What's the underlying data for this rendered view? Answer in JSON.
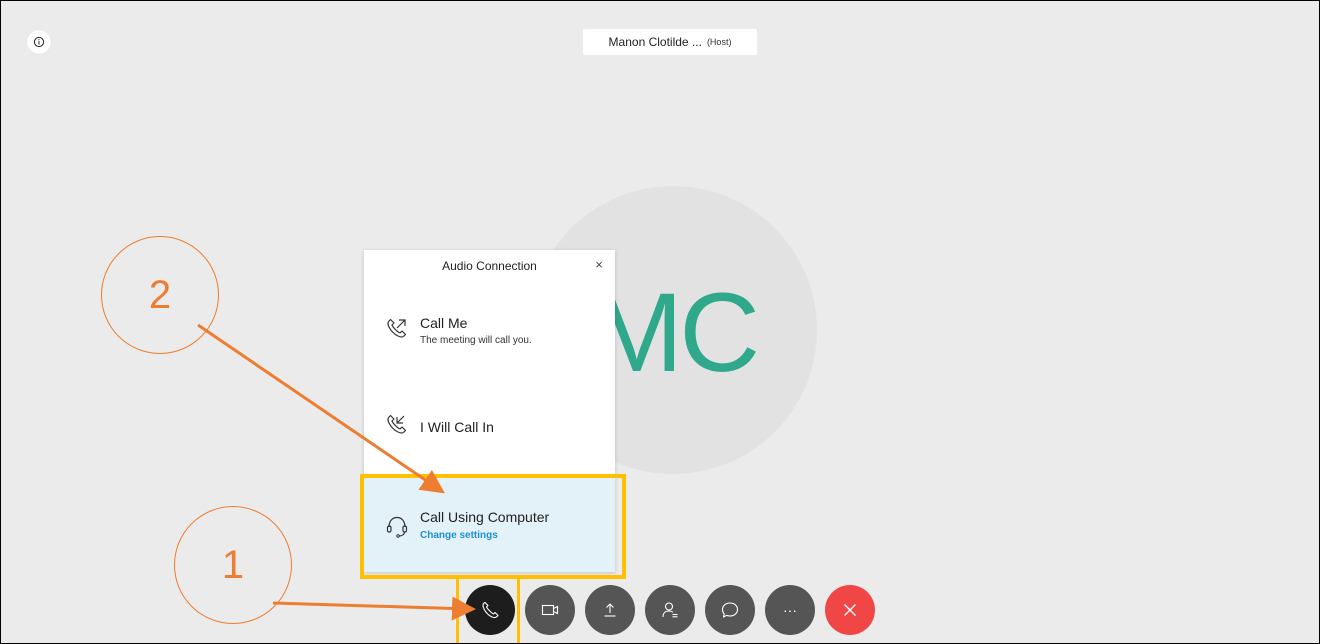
{
  "header": {
    "host_name": "Manon Clotilde ...",
    "host_tag": "(Host)"
  },
  "avatar": {
    "initials": "MC"
  },
  "audio_panel": {
    "title": "Audio Connection",
    "close": "×",
    "options": [
      {
        "label": "Call Me",
        "subtitle": "The meeting will call you.",
        "icon": "phone-outgoing-icon"
      },
      {
        "label": "I Will Call In",
        "icon": "phone-incoming-icon"
      },
      {
        "label": "Call Using Computer",
        "subtitle": "Change settings",
        "icon": "headset-icon",
        "highlighted": true
      }
    ]
  },
  "toolbar": {
    "buttons": [
      {
        "name": "audio",
        "icon": "phone-icon",
        "active": true
      },
      {
        "name": "video",
        "icon": "video-camera-icon"
      },
      {
        "name": "share",
        "icon": "upload-icon"
      },
      {
        "name": "participants",
        "icon": "participants-icon"
      },
      {
        "name": "chat",
        "icon": "chat-bubble-icon"
      },
      {
        "name": "more",
        "icon": "more-icon",
        "text": "···"
      },
      {
        "name": "end",
        "icon": "close-icon",
        "color": "#f04646"
      }
    ]
  },
  "annotations": {
    "callout_1": "1",
    "callout_2": "2",
    "arrow_color": "#ed7d31",
    "highlight_color": "#ffc000"
  },
  "colors": {
    "background": "#ebebeb",
    "avatar_text": "#30a88c",
    "link": "#1e8fd1",
    "selected_option_bg": "#e3f2f9"
  }
}
